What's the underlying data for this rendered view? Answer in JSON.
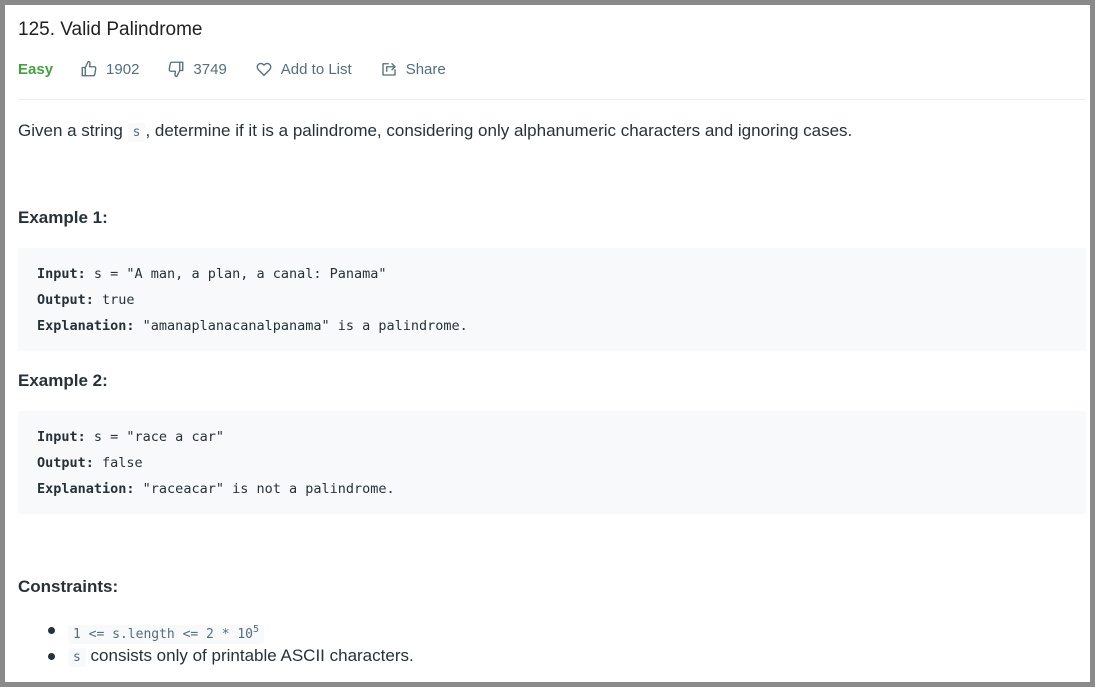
{
  "problem": {
    "title": "125. Valid Palindrome",
    "difficulty": "Easy",
    "likes": "1902",
    "dislikes": "3749",
    "add_to_list": "Add to List",
    "share": "Share"
  },
  "description": {
    "before": "Given a string ",
    "var": "s",
    "after": ", determine if it is a palindrome, considering only alphanumeric characters and ignoring cases."
  },
  "examples": [
    {
      "heading": "Example 1:",
      "input_label": "Input:",
      "input_value": " s = \"A man, a plan, a canal: Panama\"",
      "output_label": "Output:",
      "output_value": " true",
      "explanation_label": "Explanation:",
      "explanation_value": " \"amanaplanacanalpanama\" is a palindrome."
    },
    {
      "heading": "Example 2:",
      "input_label": "Input:",
      "input_value": " s = \"race a car\"",
      "output_label": "Output:",
      "output_value": " false",
      "explanation_label": "Explanation:",
      "explanation_value": " \"raceacar\" is not a palindrome."
    }
  ],
  "constraints": {
    "heading": "Constraints:",
    "items": [
      {
        "code": "1 <= s.length <= 2 * 10",
        "sup": "5"
      },
      {
        "code": "s",
        "text": " consists only of printable ASCII characters."
      }
    ]
  },
  "colors": {
    "easy": "#43a047",
    "meta": "#546e7a",
    "code_bg": "#f7f9fa",
    "frame": "#8a8a8a"
  },
  "icons": [
    "thumbs-up-icon",
    "thumbs-down-icon",
    "heart-icon",
    "share-icon"
  ]
}
